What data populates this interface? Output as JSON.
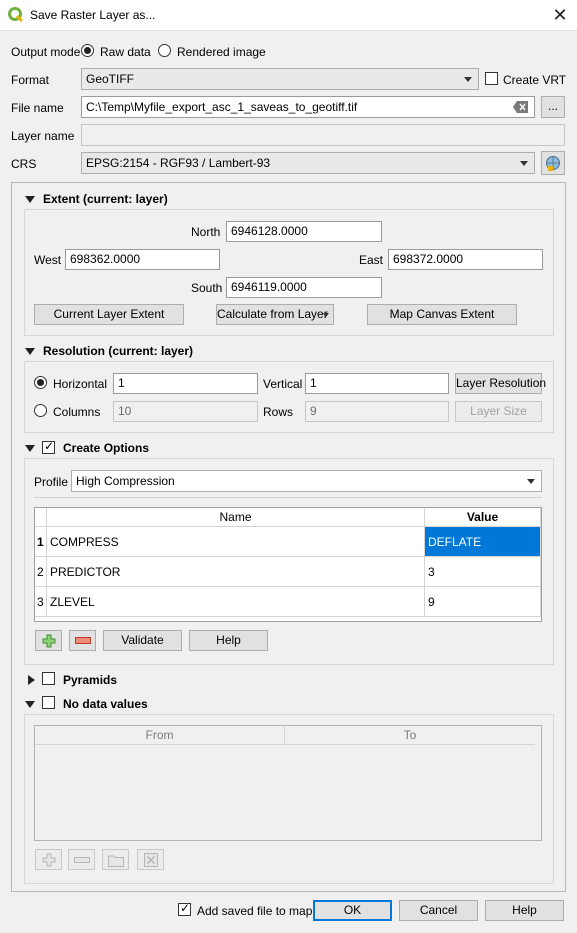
{
  "window": {
    "title": "Save Raster Layer as...",
    "close_glyph": "✕"
  },
  "output_mode": {
    "label": "Output mode",
    "raw": "Raw data",
    "rendered": "Rendered image",
    "selected": "raw"
  },
  "format": {
    "label": "Format",
    "value": "GeoTIFF",
    "create_vrt": "Create VRT"
  },
  "file_name": {
    "label": "File name",
    "value": "C:\\Temp\\Myfile_export_asc_1_saveas_to_geotiff.tif",
    "browse": "..."
  },
  "layer_name": {
    "label": "Layer name",
    "value": ""
  },
  "crs": {
    "label": "CRS",
    "value": "EPSG:2154 - RGF93 / Lambert-93"
  },
  "extent": {
    "title": "Extent (current: layer)",
    "north_label": "North",
    "north": "6946128.0000",
    "west_label": "West",
    "west": "698362.0000",
    "east_label": "East",
    "east": "698372.0000",
    "south_label": "South",
    "south": "6946119.0000",
    "btn_current": "Current Layer Extent",
    "btn_calc": "Calculate from Layer",
    "btn_canvas": "Map Canvas Extent"
  },
  "resolution": {
    "title": "Resolution (current: layer)",
    "horizontal_label": "Horizontal",
    "horizontal": "1",
    "vertical_label": "Vertical",
    "vertical": "1",
    "btn_layer_res": "Layer Resolution",
    "columns_label": "Columns",
    "columns": "10",
    "rows_label": "Rows",
    "rows": "9",
    "btn_layer_size": "Layer Size",
    "selected": "horizontal"
  },
  "create_options": {
    "title": "Create Options",
    "checked": true,
    "profile_label": "Profile",
    "profile": "High Compression",
    "columns": [
      "Name",
      "Value"
    ],
    "rows": [
      {
        "num": "1",
        "name": "COMPRESS",
        "value": "DEFLATE",
        "selected": true
      },
      {
        "num": "2",
        "name": "PREDICTOR",
        "value": "3",
        "selected": false
      },
      {
        "num": "3",
        "name": "ZLEVEL",
        "value": "9",
        "selected": false
      }
    ],
    "validate": "Validate",
    "help": "Help"
  },
  "pyramids": {
    "title": "Pyramids",
    "checked": false
  },
  "no_data": {
    "title": "No data values",
    "checked": false,
    "columns": [
      "From",
      "To"
    ]
  },
  "footer": {
    "add_to_map": "Add saved file to map",
    "add_checked": true,
    "ok": "OK",
    "cancel": "Cancel",
    "help": "Help"
  },
  "colors": {
    "accent": "#0078d7",
    "selection": "#0078d7",
    "add_icon": "#3b8f2f",
    "remove_icon": "#c0392b",
    "qgis_green": "#6fb23f"
  }
}
